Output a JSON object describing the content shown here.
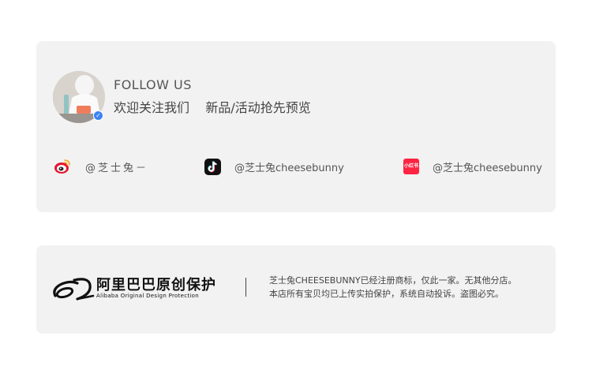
{
  "follow": {
    "title": "FOLLOW US",
    "subtitle": "欢迎关注我们    新品/活动抢先预览"
  },
  "social": [
    {
      "platform": "weibo",
      "icon": "weibo-icon",
      "handle": "@芝士兔－"
    },
    {
      "platform": "douyin",
      "icon": "tiktok-icon",
      "handle": "@芝士兔cheesebunny"
    },
    {
      "platform": "xiaohongshu",
      "icon": "xiaohongshu-icon",
      "icon_text": "小红书",
      "handle": "@芝士兔cheesebunny"
    }
  ],
  "protection": {
    "logo_cn": "阿里巴巴原创保护",
    "logo_en": "Alibaba Original Design Protection",
    "notice_line1": "芝士兔CHEESEBUNNY已经注册商标，仅此一家。无其他分店。",
    "notice_line2": "本店所有宝贝均已上传实拍保护，系统自动投诉。盗图必究。"
  },
  "colors": {
    "card_bg": "#f2f2f2",
    "verified_badge": "#3b82f6",
    "xiaohongshu": "#ff2442",
    "weibo": "#e6162d"
  }
}
